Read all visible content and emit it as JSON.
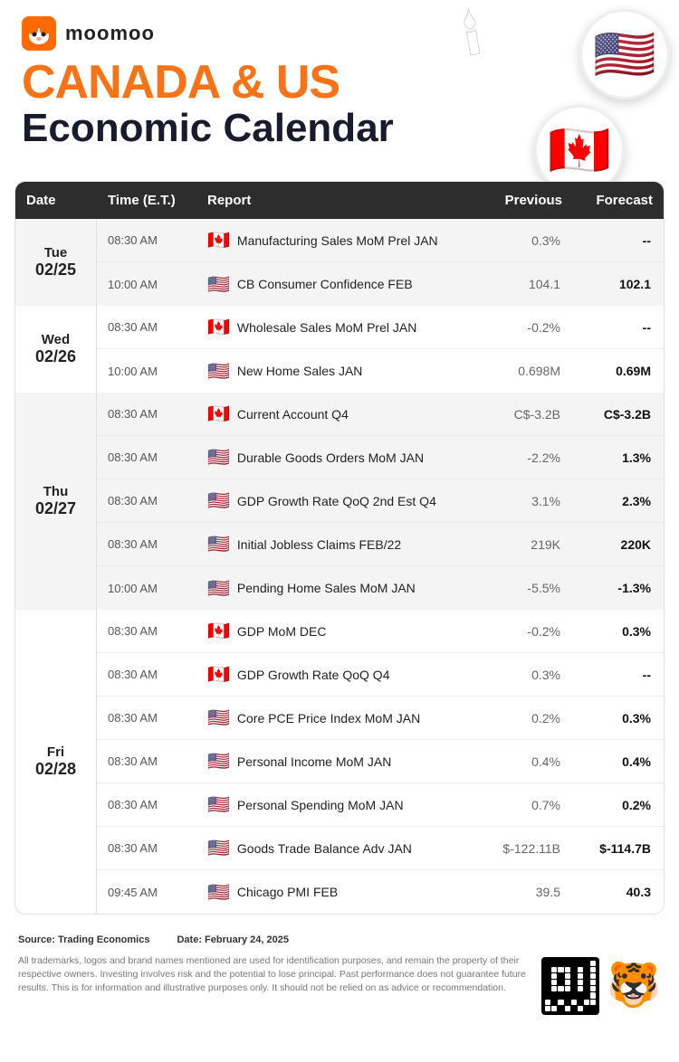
{
  "header": {
    "logo_text": "moomoo",
    "title_line1": "CANADA & US",
    "title_line2": "Economic Calendar"
  },
  "table": {
    "columns": [
      "Date",
      "Time (E.T.)",
      "Report",
      "Previous",
      "Forecast"
    ],
    "days": [
      {
        "day_name": "Tue",
        "day_date": "02/25",
        "bg": "light",
        "reports": [
          {
            "time": "08:30 AM",
            "flag": "🇨🇦",
            "report": "Manufacturing Sales MoM Prel JAN",
            "previous": "0.3%",
            "forecast": "--"
          },
          {
            "time": "10:00 AM",
            "flag": "🇺🇸",
            "report": "CB Consumer Confidence FEB",
            "previous": "104.1",
            "forecast": "102.1"
          }
        ]
      },
      {
        "day_name": "Wed",
        "day_date": "02/26",
        "bg": "white",
        "reports": [
          {
            "time": "08:30 AM",
            "flag": "🇨🇦",
            "report": "Wholesale Sales MoM Prel JAN",
            "previous": "-0.2%",
            "forecast": "--"
          },
          {
            "time": "10:00 AM",
            "flag": "🇺🇸",
            "report": "New Home Sales JAN",
            "previous": "0.698M",
            "forecast": "0.69M"
          }
        ]
      },
      {
        "day_name": "Thu",
        "day_date": "02/27",
        "bg": "light",
        "reports": [
          {
            "time": "08:30 AM",
            "flag": "🇨🇦",
            "report": "Current Account Q4",
            "previous": "C$-3.2B",
            "forecast": "C$-3.2B"
          },
          {
            "time": "08:30 AM",
            "flag": "🇺🇸",
            "report": "Durable Goods Orders MoM JAN",
            "previous": "-2.2%",
            "forecast": "1.3%"
          },
          {
            "time": "08:30 AM",
            "flag": "🇺🇸",
            "report": "GDP Growth Rate QoQ 2nd Est Q4",
            "previous": "3.1%",
            "forecast": "2.3%"
          },
          {
            "time": "08:30 AM",
            "flag": "🇺🇸",
            "report": "Initial Jobless Claims FEB/22",
            "previous": "219K",
            "forecast": "220K"
          },
          {
            "time": "10:00 AM",
            "flag": "🇺🇸",
            "report": "Pending Home Sales MoM JAN",
            "previous": "-5.5%",
            "forecast": "-1.3%"
          }
        ]
      },
      {
        "day_name": "Fri",
        "day_date": "02/28",
        "bg": "white",
        "reports": [
          {
            "time": "08:30 AM",
            "flag": "🇨🇦",
            "report": "GDP MoM DEC",
            "previous": "-0.2%",
            "forecast": "0.3%"
          },
          {
            "time": "08:30 AM",
            "flag": "🇨🇦",
            "report": "GDP Growth Rate QoQ Q4",
            "previous": "0.3%",
            "forecast": "--"
          },
          {
            "time": "08:30 AM",
            "flag": "🇺🇸",
            "report": "Core PCE Price Index MoM JAN",
            "previous": "0.2%",
            "forecast": "0.3%"
          },
          {
            "time": "08:30 AM",
            "flag": "🇺🇸",
            "report": "Personal Income MoM JAN",
            "previous": "0.4%",
            "forecast": "0.4%"
          },
          {
            "time": "08:30 AM",
            "flag": "🇺🇸",
            "report": "Personal Spending MoM JAN",
            "previous": "0.7%",
            "forecast": "0.2%"
          },
          {
            "time": "08:30 AM",
            "flag": "🇺🇸",
            "report": "Goods Trade Balance Adv JAN",
            "previous": "$-122.11B",
            "forecast": "$-114.7B"
          },
          {
            "time": "09:45 AM",
            "flag": "🇺🇸",
            "report": "Chicago PMI FEB",
            "previous": "39.5",
            "forecast": "40.3"
          }
        ]
      }
    ]
  },
  "footer": {
    "source_label": "Source: Trading Economics",
    "date_label": "Date: February 24, 2025",
    "disclaimer": "All trademarks, logos and brand names mentioned are used for identification purposes, and remain the property of their respective owners. Investing involves risk and the potential to lose principal. Past performance does not guarantee future results. This is for information and illustrative purposes only. It should not be relied on as advice or recommendation."
  }
}
